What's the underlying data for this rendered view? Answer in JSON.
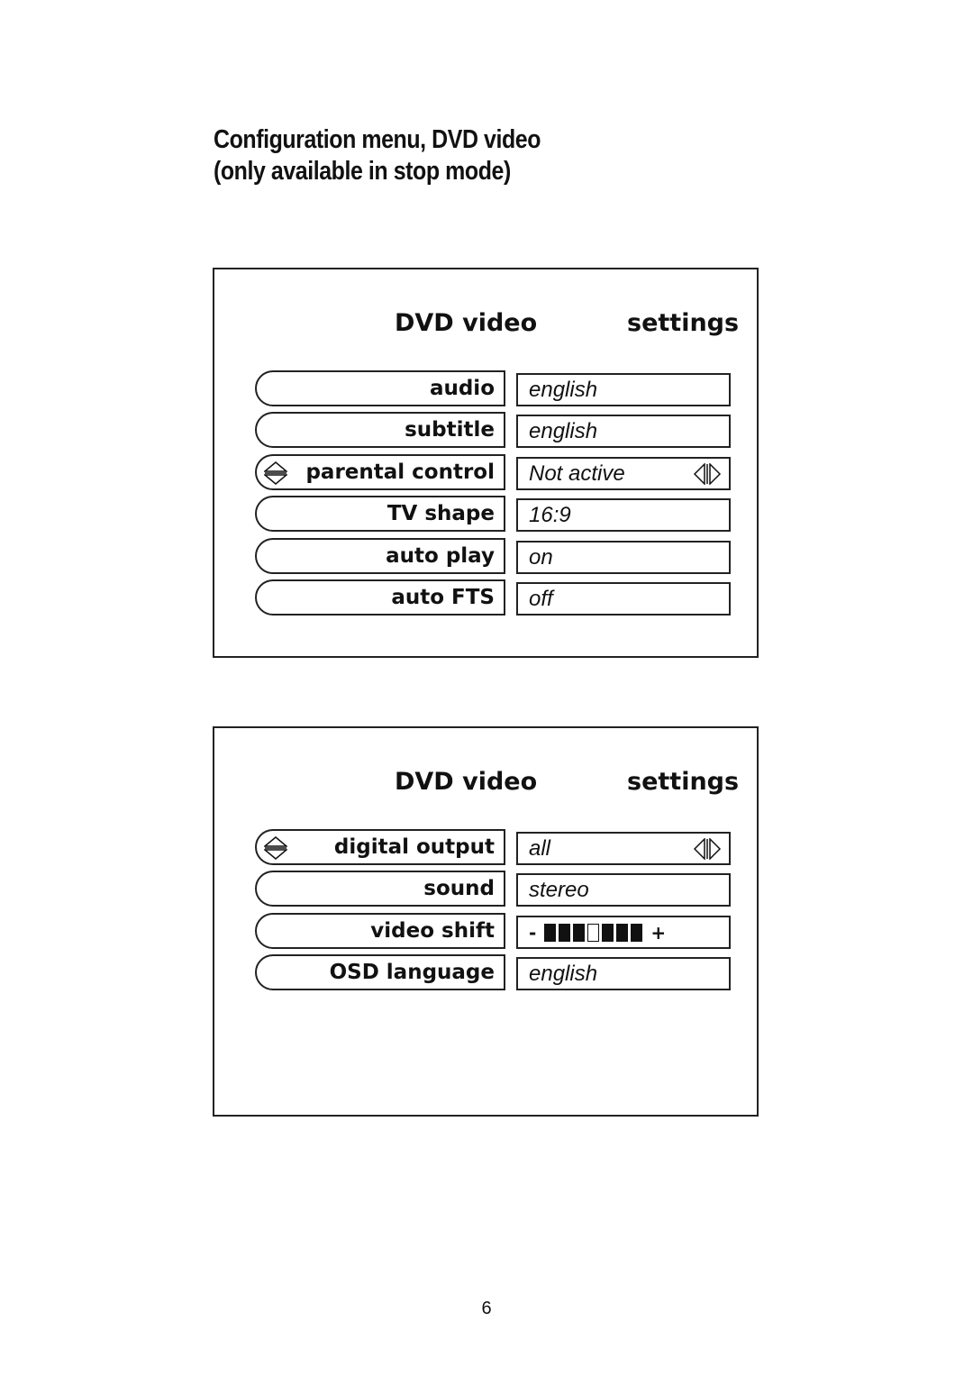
{
  "heading": {
    "line1": "Configuration menu, DVD video",
    "line2": "(only available in stop mode)"
  },
  "menus": [
    {
      "title_left": "DVD video",
      "title_right": "settings",
      "rows": [
        {
          "label": "audio",
          "value": "english",
          "selected": false
        },
        {
          "label": "subtitle",
          "value": "english",
          "selected": false
        },
        {
          "label": "parental control",
          "value": "Not active",
          "selected": true,
          "icons": [
            "up-down-arrows-icon",
            "left-right-arrows-icon"
          ]
        },
        {
          "label": "TV shape",
          "value": "16:9",
          "selected": false
        },
        {
          "label": "auto play",
          "value": "on",
          "selected": false
        },
        {
          "label": "auto FTS",
          "value": "off",
          "selected": false
        }
      ]
    },
    {
      "title_left": "DVD video",
      "title_right": "settings",
      "rows": [
        {
          "label": "digital output",
          "value": "all",
          "selected": true,
          "icons": [
            "up-down-arrows-icon",
            "left-right-arrows-icon"
          ]
        },
        {
          "label": "sound",
          "value": "stereo",
          "selected": false
        },
        {
          "label": "video shift",
          "value": {
            "minus": "-",
            "plus": "+",
            "segments": 7,
            "position": 4
          },
          "selected": false
        },
        {
          "label": "OSD language",
          "value": "english",
          "selected": false
        }
      ]
    }
  ],
  "page_number": "6"
}
